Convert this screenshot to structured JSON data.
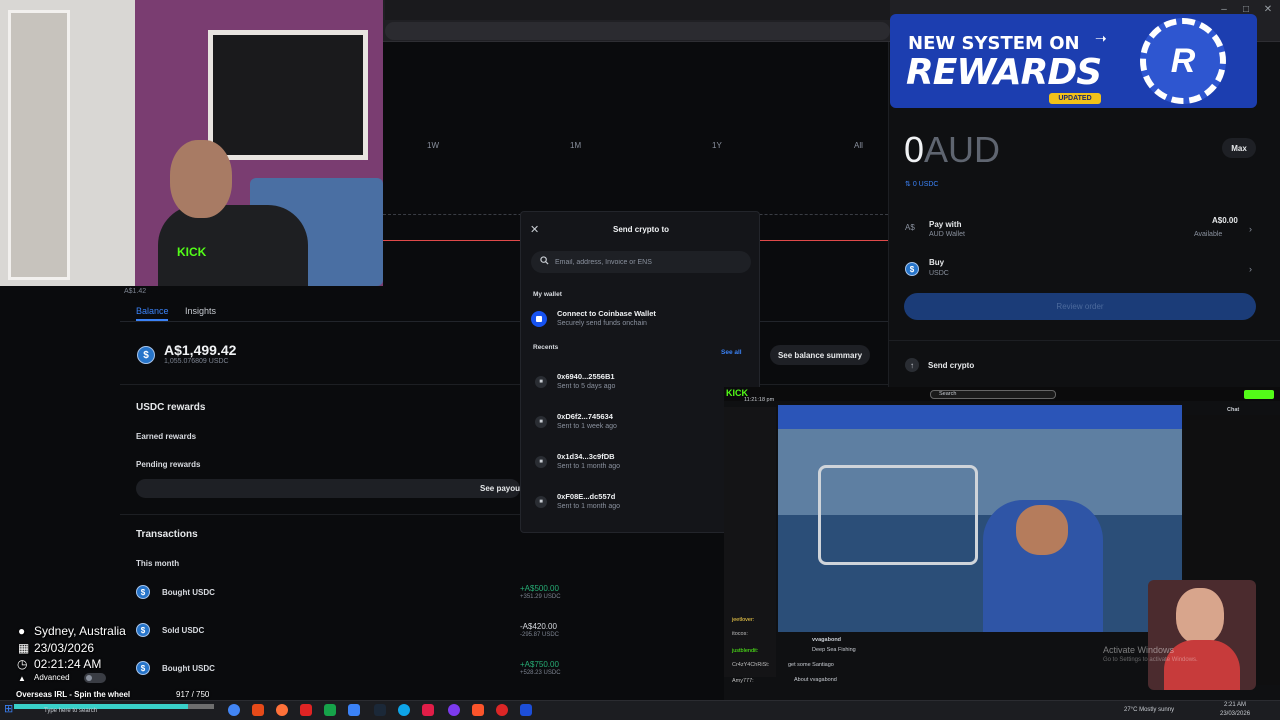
{
  "app": {
    "time_tabs": [
      "1W",
      "1M",
      "1Y",
      "All"
    ],
    "price_tick": "A$1.42",
    "tabs": [
      "Balance",
      "Insights"
    ],
    "balance": {
      "amount": "A$1,499.42",
      "sub": "1,055.076809 USDC"
    },
    "see_balance_summary": "See balance summary",
    "rewards": {
      "title": "USDC rewards",
      "earned_label": "Earned rewards",
      "pending_label": "Pending rewards",
      "see_payout": "See payou"
    },
    "transactions": {
      "title": "Transactions",
      "period": "This month",
      "items": [
        {
          "name": "Bought USDC",
          "amount": "+A$500.00",
          "sub": "+351.29 USDC",
          "tone": "green"
        },
        {
          "name": "Sold USDC",
          "amount": "-A$420.00",
          "sub": "-295.87 USDC",
          "tone": "neutral"
        },
        {
          "name": "Bought USDC",
          "amount": "+A$750.00",
          "sub": "+528.23 USDC",
          "tone": "green"
        }
      ]
    }
  },
  "modal": {
    "title": "Send crypto to",
    "search_placeholder": "Email, address, Invoice or ENS",
    "my_wallet_label": "My wallet",
    "connect_title": "Connect to Coinbase Wallet",
    "connect_sub": "Securely send funds onchain",
    "recents_label": "Recents",
    "see_all": "See all",
    "recents": [
      {
        "address": "0x6940...2556B1",
        "sub": "Sent to 5 days ago"
      },
      {
        "address": "0xD6f2...745634",
        "sub": "Sent to 1 week ago"
      },
      {
        "address": "0x1d34...3c9fDB",
        "sub": "Sent to 1 month ago"
      },
      {
        "address": "0xF08E...dc557d",
        "sub": "Sent to 1 month ago"
      }
    ]
  },
  "trade_panel": {
    "amount": "0",
    "currency": "AUD",
    "max_label": "Max",
    "usdc_equiv": "0 USDC",
    "pay_with": {
      "title": "Pay with",
      "sub": "AUD Wallet",
      "value": "A$0.00",
      "available": "Available"
    },
    "buy": {
      "title": "Buy",
      "sub": "USDC"
    },
    "review_label": "Review order",
    "send_crypto": "Send crypto"
  },
  "promo": {
    "line1": "NEW SYSTEM ON",
    "line2": "REWARDS",
    "badge": "UPDATED",
    "logo_letter": "R"
  },
  "webcam": {
    "shirt_text": "KICK"
  },
  "stream": {
    "brand": "KICK",
    "clock": "11:21:18 pm",
    "chat_title": "Chat",
    "streamer": "vvagabond",
    "stream_title": "Deep Sea Fishing",
    "chat_lines": [
      "jeetlover:",
      "itocos:",
      "justblendit:",
      "Cr4zY4ChRiSt:",
      "Amy777:"
    ],
    "chat_message": "get some Santiago",
    "about": "About vvagabond",
    "search_placeholder": "Search"
  },
  "overlay": {
    "location": "Sydney, Australia",
    "date": "23/03/2026",
    "time": "02:21:24 AM",
    "advanced": "Advanced",
    "segment": "Overseas IRL - Spin the wheel",
    "progress_label": "917 / 750",
    "progress_fraction": 0.87
  },
  "windows": {
    "activate_title": "Activate Windows",
    "activate_sub": "Go to Settings to activate Windows.",
    "search_placeholder": "Type here to search",
    "weather": "27°C  Mostly sunny",
    "clock_time": "2:21 AM",
    "clock_date": "23/03/2026"
  },
  "colors": {
    "accent_blue": "#3b82f6",
    "positive_green": "#27ad75",
    "chart_red": "#e04a4a",
    "promo_blue": "#1c3eb0",
    "progress_teal": "#39d0c9"
  }
}
